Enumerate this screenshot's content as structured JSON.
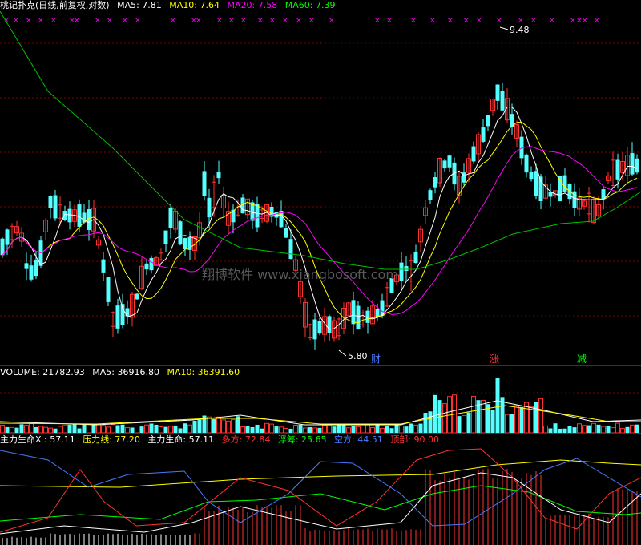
{
  "colors": {
    "background": "#000000",
    "up_candle": "#ff3232",
    "down_candle": "#54ffff",
    "ma5": "#ffffff",
    "ma10": "#ffff00",
    "ma20": "#ff00ff",
    "ma60": "#00c000",
    "separator": "#b00000",
    "grid": "#800000"
  },
  "main_panel": {
    "title": "桃记扑克(日线,前复权,对数)",
    "ma5_label": "MA5: 7.81",
    "ma10_label": "MA10: 7.64",
    "ma20_label": "MA20: 7.58",
    "ma60_label": "MA60: 7.39",
    "high_label": "9.48",
    "low_label": "5.80",
    "event_labels": [
      "财",
      "涨",
      "减"
    ],
    "watermark": "翔博软件  www.xiangbosoft.com"
  },
  "volume_panel": {
    "volume_label": "VOLUME: 21782.93",
    "ma5_label": "MA5: 36916.80",
    "ma10_label": "MA10: 36391.60"
  },
  "indicator_panel": {
    "label_x": "主力生命X : 57.11",
    "pressure_label": "压力线: 77.20",
    "life_label": "主力生命: 57.11",
    "long_label": "多方: 72.84",
    "float_label": "浮筹: 25.65",
    "short_label": "空方: 44.51",
    "top_label": "顶部: 90.00"
  }
}
